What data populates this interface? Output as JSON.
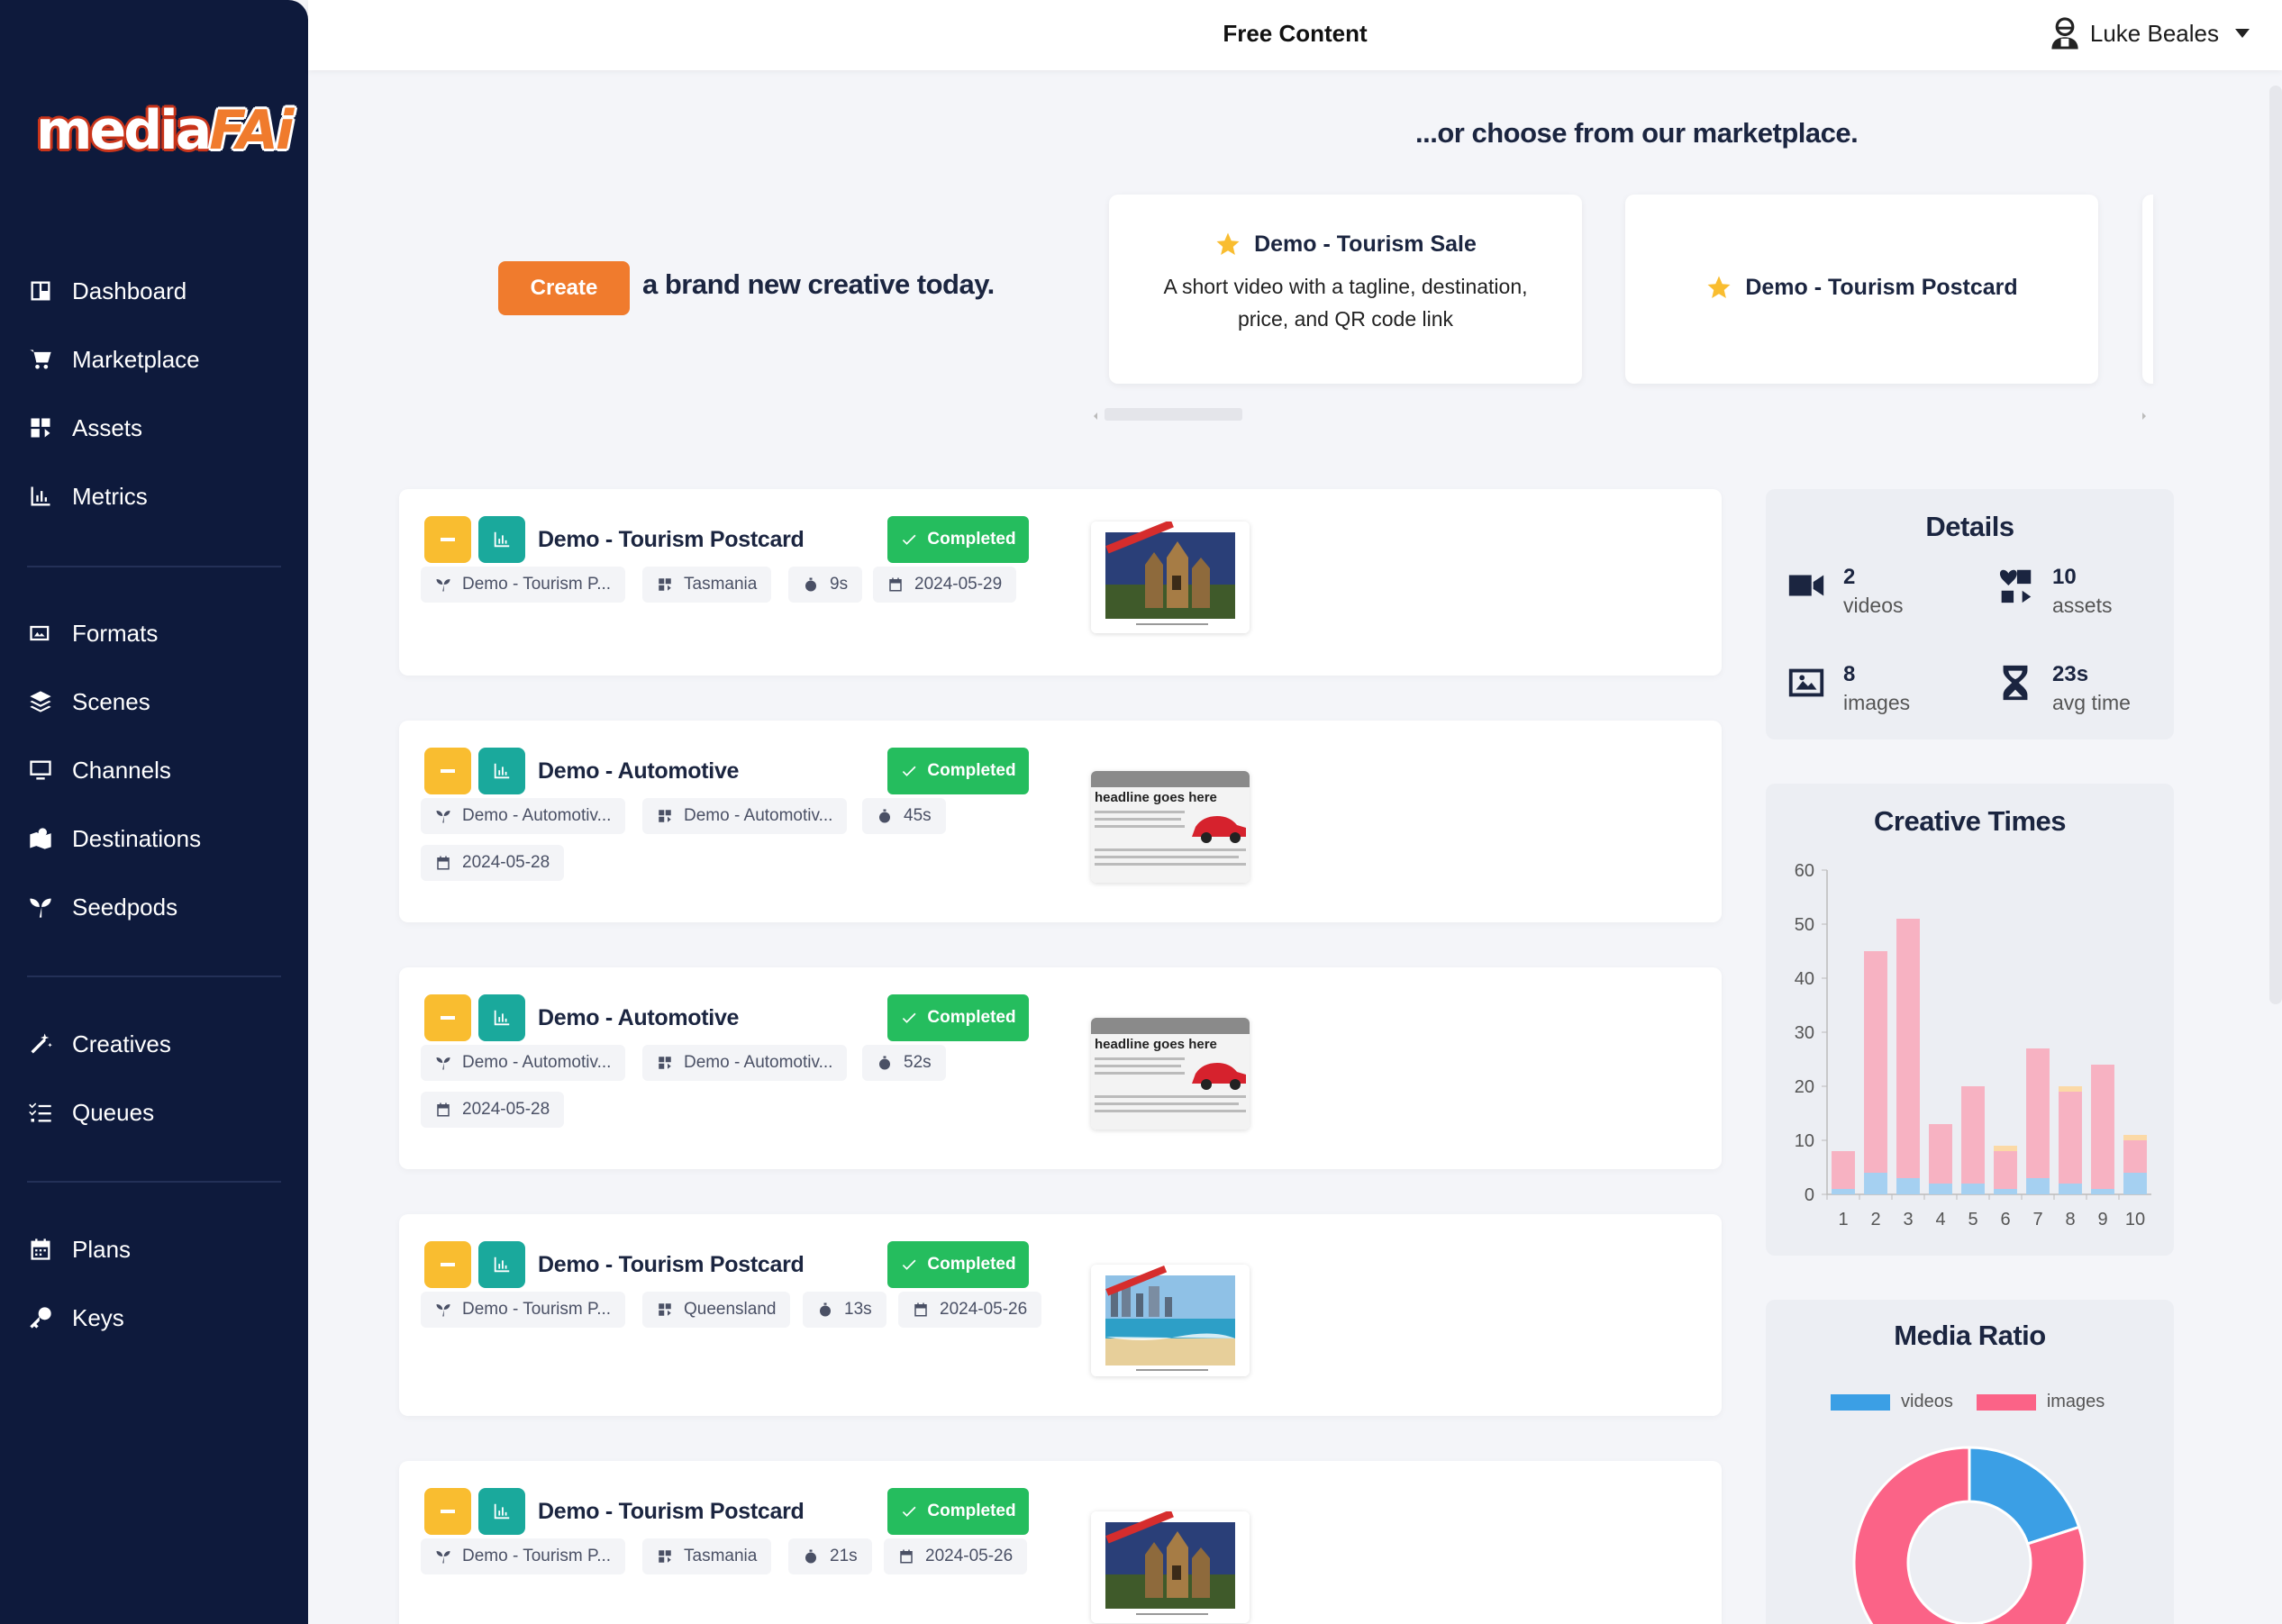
{
  "header": {
    "title": "Free Content",
    "user_name": "Luke Beales"
  },
  "sidebar": {
    "logo_text_1": "media",
    "logo_text_2": "FAi",
    "groups": [
      [
        {
          "label": "Dashboard",
          "icon": "dashboard-icon"
        },
        {
          "label": "Marketplace",
          "icon": "cart-icon"
        },
        {
          "label": "Assets",
          "icon": "assets-icon"
        },
        {
          "label": "Metrics",
          "icon": "metrics-icon"
        }
      ],
      [
        {
          "label": "Formats",
          "icon": "formats-icon"
        },
        {
          "label": "Scenes",
          "icon": "layers-icon"
        },
        {
          "label": "Channels",
          "icon": "monitor-icon"
        },
        {
          "label": "Destinations",
          "icon": "map-icon"
        },
        {
          "label": "Seedpods",
          "icon": "seedling-icon"
        }
      ],
      [
        {
          "label": "Creatives",
          "icon": "magic-wand-icon"
        },
        {
          "label": "Queues",
          "icon": "list-icon"
        }
      ],
      [
        {
          "label": "Plans",
          "icon": "calendar-icon"
        },
        {
          "label": "Keys",
          "icon": "key-icon"
        }
      ]
    ]
  },
  "hero": {
    "create_label": "Create",
    "create_text": "a brand new creative today.",
    "market_title": "...or choose from our marketplace."
  },
  "marketplace": [
    {
      "name": "Demo - Tourism Sale",
      "desc": "A short video with a tagline, destination, price, and QR code link"
    },
    {
      "name": "Demo - Tourism Postcard",
      "desc": ""
    }
  ],
  "creatives": [
    {
      "name": "Demo - Tourism Postcard",
      "status": "Completed",
      "seedpod": "Demo - Tourism P...",
      "destination": "Tasmania",
      "duration": "9s",
      "date": "2024-05-29",
      "thumb": "church"
    },
    {
      "name": "Demo - Automotive",
      "status": "Completed",
      "seedpod": "Demo - Automotiv...",
      "destination": "Demo - Automotiv...",
      "duration": "45s",
      "date": "2024-05-28",
      "thumb": "car",
      "headline": "headline goes here"
    },
    {
      "name": "Demo - Automotive",
      "status": "Completed",
      "seedpod": "Demo - Automotiv...",
      "destination": "Demo - Automotiv...",
      "duration": "52s",
      "date": "2024-05-28",
      "thumb": "car",
      "headline": "headline goes here"
    },
    {
      "name": "Demo - Tourism Postcard",
      "status": "Completed",
      "seedpod": "Demo - Tourism P...",
      "destination": "Queensland",
      "duration": "13s",
      "date": "2024-05-26",
      "thumb": "beach"
    },
    {
      "name": "Demo - Tourism Postcard",
      "status": "Completed",
      "seedpod": "Demo - Tourism P...",
      "destination": "Tasmania",
      "duration": "21s",
      "date": "2024-05-26",
      "thumb": "church"
    }
  ],
  "details": {
    "title": "Details",
    "stats": [
      {
        "num": "2",
        "label": "videos",
        "icon": "video-icon"
      },
      {
        "num": "10",
        "label": "assets",
        "icon": "assets-icon"
      },
      {
        "num": "8",
        "label": "images",
        "icon": "image-icon"
      },
      {
        "num": "23s",
        "label": "avg time",
        "icon": "hourglass-icon"
      }
    ]
  },
  "chart_data": [
    {
      "type": "bar",
      "title": "Creative Times",
      "categories": [
        "1",
        "2",
        "3",
        "4",
        "5",
        "6",
        "7",
        "8",
        "9",
        "10"
      ],
      "stacked": true,
      "ylim": [
        0,
        60
      ],
      "yticks": [
        0,
        10,
        20,
        30,
        40,
        50,
        60
      ],
      "series": [
        {
          "values": [
            1,
            4,
            3,
            2,
            2,
            1,
            3,
            2,
            1,
            4
          ],
          "color": "#a5d0f1"
        },
        {
          "values": [
            7,
            41,
            48,
            11,
            18,
            7,
            24,
            17,
            23,
            6
          ],
          "color": "#f7b2c2"
        },
        {
          "values": [
            0,
            0,
            0,
            0,
            0,
            1,
            0,
            1,
            0,
            1
          ],
          "color": "#fbd9a6"
        }
      ]
    },
    {
      "type": "pie",
      "title": "Media Ratio",
      "legend": [
        "videos",
        "images"
      ],
      "values": [
        2,
        8
      ],
      "colors": [
        "#3b9fe5",
        "#fb6387"
      ]
    }
  ]
}
